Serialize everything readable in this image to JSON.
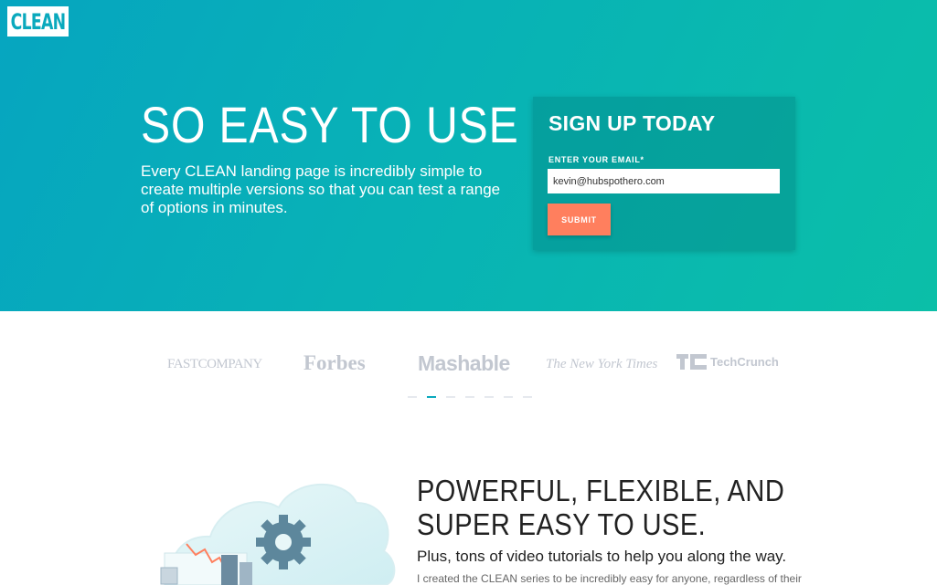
{
  "header": {
    "logo_text": "CLEAN"
  },
  "hero": {
    "title": "SO EASY TO USE",
    "subtitle": "Every CLEAN landing page is incredibly simple to create multiple versions so that you can test a range of options in minutes."
  },
  "signup": {
    "title": "SIGN UP TODAY",
    "email_label": "ENTER YOUR EMAIL*",
    "email_value": "kevin@hubspothero.com",
    "submit_label": "SUBMIT"
  },
  "press": {
    "logos": [
      "FASTCOMPANY",
      "Forbes",
      "Mashable",
      "The New York Times",
      "TechCrunch"
    ],
    "carousel_dots": 7,
    "active_dot": 1
  },
  "feature": {
    "title": "POWERFUL, FLEXIBLE, AND SUPER EASY TO USE.",
    "subtitle": "Plus, tons of video tutorials to help you along the way.",
    "body": "I created the CLEAN series to be incredibly easy for anyone, regardless of their"
  },
  "colors": {
    "hero_gradient_start": "#06a5c0",
    "hero_gradient_end": "#0bbfa8",
    "accent_button": "#ff7f5e",
    "press_logo_gray": "#c2c7d0"
  }
}
